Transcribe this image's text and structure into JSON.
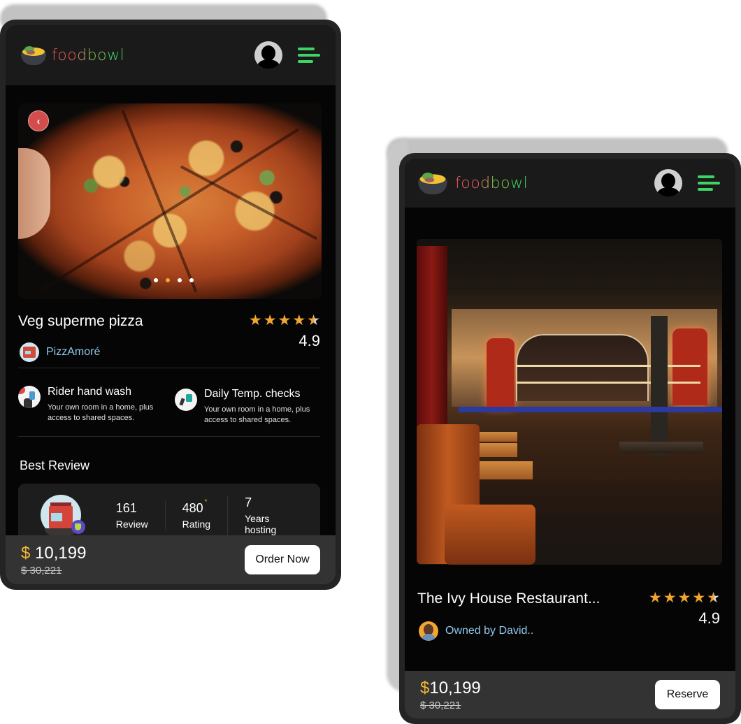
{
  "phones": [
    {
      "header": {
        "logo": [
          "foo",
          "d",
          "bo",
          "wl"
        ],
        "avatar_icon": "user-avatar-icon",
        "menu_icon": "hamburger-menu-icon"
      },
      "hero": {
        "image": "pizza-photo",
        "back_icon": "chevron-left-icon",
        "back_glyph": "‹",
        "carousel_dots": 4,
        "active_dot": 2
      },
      "title": "Veg superme pizza",
      "rating": {
        "stars": 4.5,
        "value": "4.9",
        "star_glyph": "★"
      },
      "vendor": {
        "name": "PizzAmoré",
        "avatar_icon": "restaurant-shop-icon"
      },
      "features": [
        {
          "icon": "hand-wash-icon",
          "title": "Rider hand wash",
          "desc": "Your own room in a home, plus access to shared spaces."
        },
        {
          "icon": "thermometer-gun-icon",
          "title": "Daily Temp. checks",
          "desc": "Your own room in a home, plus access to shared spaces."
        }
      ],
      "best_review": {
        "title": "Best Review",
        "stats": [
          {
            "value": "161",
            "label": "Review"
          },
          {
            "value": "480",
            "label": "Rating",
            "badge": "*"
          },
          {
            "value": "7",
            "label": "Years hosting"
          }
        ]
      },
      "price": {
        "currency": "$",
        "current": "10,199",
        "original": "$ 30,221"
      },
      "cta": "Order Now"
    },
    {
      "header": {
        "logo": [
          "foo",
          "d",
          "bo",
          "wl"
        ],
        "avatar_icon": "user-avatar-icon",
        "menu_icon": "hamburger-menu-icon"
      },
      "hero": {
        "image": "restaurant-interior-photo"
      },
      "title": "The Ivy House Restaurant...",
      "rating": {
        "stars": 4.5,
        "value": "4.9",
        "star_glyph": "★"
      },
      "vendor": {
        "name": "Owned by David..",
        "avatar_icon": "owner-avatar"
      },
      "price": {
        "currency": "$",
        "current": "10,199",
        "original": "$ 30,221"
      },
      "cta": "Reserve"
    }
  ],
  "colors": {
    "accent_star": "#f2a531",
    "price_currency": "#f2b731",
    "link": "#8ec7ea",
    "menu_green": "#3ed365",
    "back_button": "#d44d4d"
  }
}
